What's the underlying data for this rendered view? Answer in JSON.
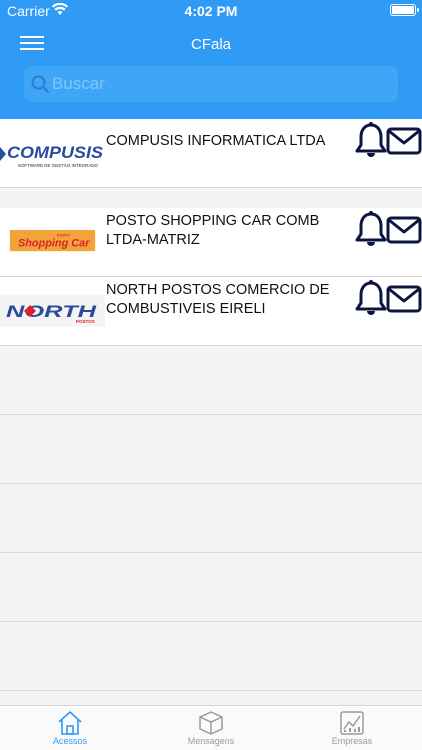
{
  "status_bar": {
    "carrier": "Carrier",
    "time": "4:02 PM"
  },
  "header": {
    "title": "CFala"
  },
  "search": {
    "placeholder": "Buscar"
  },
  "companies": [
    {
      "name": "COMPUSIS INFORMATICA LTDA",
      "logo_text": "COMPUSIS",
      "logo_subtext": "SOFTWARE DE GESTÃO INTEGRADO"
    },
    {
      "name": "POSTO SHOPPING CAR COMB LTDA-MATRIZ",
      "logo_text": "Shopping Car",
      "logo_subtext": "POSTO"
    },
    {
      "name": "NORTH POSTOS COMERCIO DE COMBUSTIVEIS EIRELI",
      "logo_text": "NORTH",
      "logo_subtext": "POSTOS"
    }
  ],
  "tabs": [
    {
      "label": "Acessos",
      "icon": "home-icon",
      "active": true
    },
    {
      "label": "Mensagens",
      "icon": "box-icon",
      "active": false
    },
    {
      "label": "Empresas",
      "icon": "chart-icon",
      "active": false
    }
  ],
  "colors": {
    "primary": "#2f9bf5",
    "icon_navy": "#0d1440",
    "logo_orange": "#f2a43a",
    "logo_red": "#d8232a",
    "logo_blue": "#2a4b9c"
  }
}
